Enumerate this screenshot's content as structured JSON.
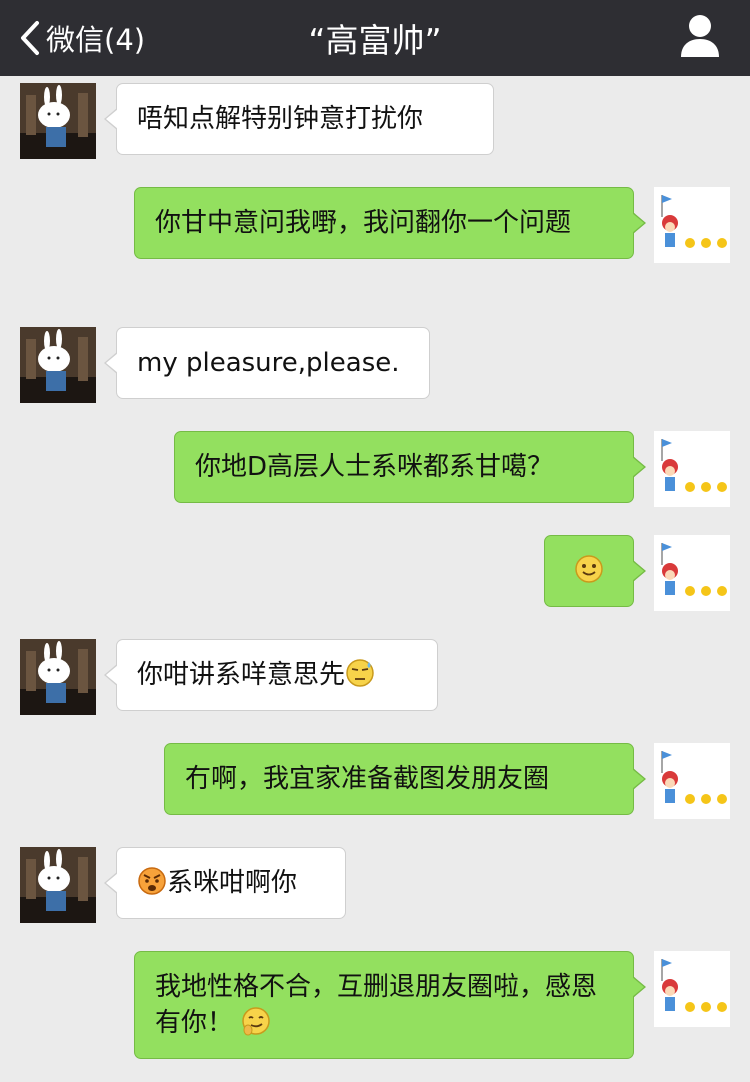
{
  "header": {
    "back_label": "微信(4)",
    "title": "“高富帅”",
    "profile_icon": "person-icon"
  },
  "colors": {
    "header_bg": "#2e2e33",
    "chat_bg": "#ebebeb",
    "outgoing_bubble": "#93e05f",
    "incoming_bubble": "#ffffff"
  },
  "messages": [
    {
      "direction": "incoming",
      "text": "唔知点解特别钟意打扰你"
    },
    {
      "direction": "outgoing",
      "text": "你甘中意问我嘢，我问翻你一个问题"
    },
    {
      "direction": "incoming",
      "text": "my pleasure,please."
    },
    {
      "direction": "outgoing",
      "text": "你地D高层人士系咪都系甘噶？"
    },
    {
      "direction": "outgoing",
      "text": "",
      "emoji": "smile-emoji"
    },
    {
      "direction": "incoming",
      "text": "你咁讲系咩意思先",
      "emoji": "sweat-emoji"
    },
    {
      "direction": "outgoing",
      "text": "冇啊，我宜家准备截图发朋友圈"
    },
    {
      "direction": "incoming",
      "text": "系咪咁啊你",
      "emoji": "angry-emoji"
    },
    {
      "direction": "outgoing",
      "text": "我地性格不合，互删退朋友圈啦，感恩有你！",
      "emoji": "smirk-emoji"
    }
  ]
}
